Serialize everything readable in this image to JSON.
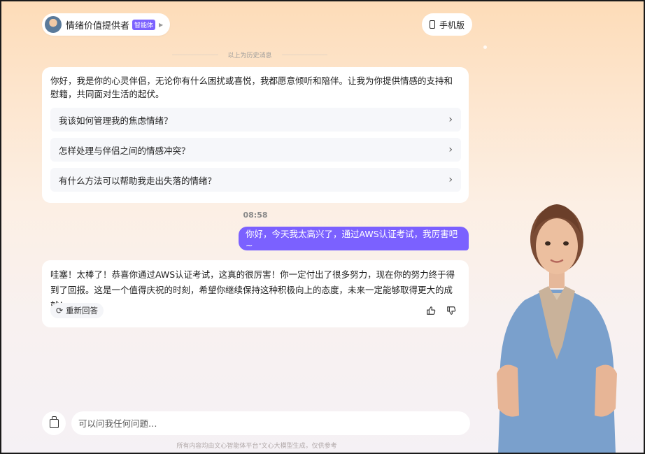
{
  "header": {
    "agent_name": "情绪价值提供者",
    "agent_badge": "智能体",
    "mobile_label": "手机版"
  },
  "history_divider": "以上为历史消息",
  "greeting": {
    "text": "你好，我是你的心灵伴侣，无论你有什么困扰或喜悦，我都愿意倾听和陪伴。让我为你提供情感的支持和慰籍，共同面对生活的起伏。",
    "suggestions": [
      "我该如何管理我的焦虑情绪？",
      "怎样处理与伴侣之间的情感冲突？",
      "有什么方法可以帮助我走出失落的情绪？"
    ]
  },
  "timestamp": "08:58",
  "user_message": "你好，今天我太高兴了，通过AWS认证考试，我厉害吧~",
  "reply": {
    "text": "哇塞！太棒了！恭喜你通过AWS认证考试，这真的很厉害！你一定付出了很多努力，现在你的努力终于得到了回报。这是一个值得庆祝的时刻，希望你继续保持这种积极向上的态度，未来一定能够取得更大的成就！",
    "regenerate_label": "重新回答"
  },
  "input": {
    "placeholder": "可以问我任何问题…"
  },
  "footnote": "所有内容均由文心智能体平台\"文心大模型生成，仅供参考",
  "colors": {
    "accent": "#7b61ff",
    "card_bg": "#ffffff",
    "suggestion_bg": "#f6f7fa"
  }
}
